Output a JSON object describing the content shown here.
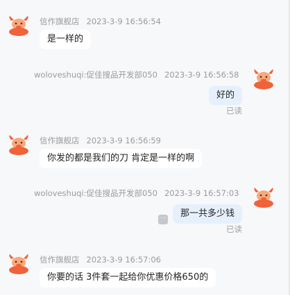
{
  "messages": [
    {
      "sender": "信作旗舰店",
      "time": "2023-3-9 16:56:54",
      "text": "是一样的"
    },
    {
      "sender": "woloveshuqi:促佳搜品开发部050",
      "time": "2023-3-9 16:56:58",
      "text": "好的",
      "status": "已读"
    },
    {
      "sender": "信作旗舰店",
      "time": "2023-3-9 16:56:59",
      "text": "你发的都是我们的刀 肯定是一样的啊"
    },
    {
      "sender": "woloveshuqi:促佳搜品开发部050",
      "time": "2023-3-9 16:57:03",
      "text": "那一共多少钱",
      "status": "已读"
    },
    {
      "sender": "信作旗舰店",
      "time": "2023-3-9 16:57:06",
      "text": "你要的话 3件套一起给你优惠价格650的"
    }
  ],
  "colors": {
    "page_bg": "#f7f8fa",
    "incoming_bubble": "#ffffff",
    "outgoing_bubble": "#e6f0fd",
    "meta_text": "#9b9b9b",
    "avatar_primary": "#f0623a",
    "avatar_secondary": "#f7a97a"
  },
  "icons": {
    "avatar": "bull-mascot-icon",
    "more": "ellipsis-icon"
  },
  "more_glyph": "⋯"
}
